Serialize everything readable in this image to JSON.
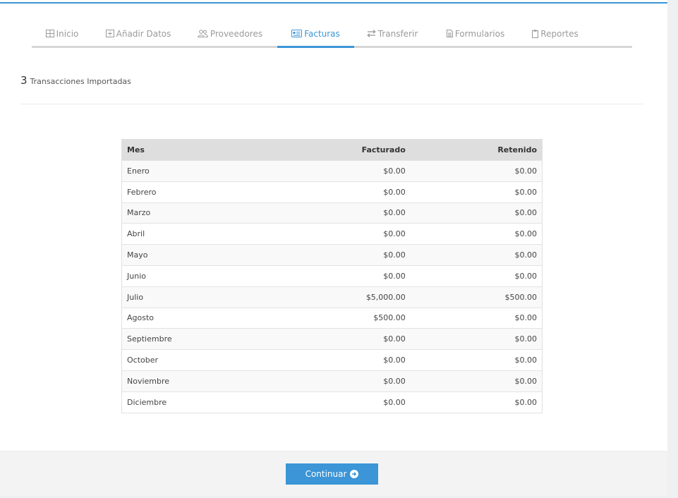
{
  "tabs": [
    {
      "label": "Inicio",
      "icon": "table-icon",
      "active": false
    },
    {
      "label": "Añadir Datos",
      "icon": "plus-square-icon",
      "active": false
    },
    {
      "label": "Proveedores",
      "icon": "users-icon",
      "active": false
    },
    {
      "label": "Facturas",
      "icon": "id-card-icon",
      "active": true
    },
    {
      "label": "Transferir",
      "icon": "exchange-icon",
      "active": false
    },
    {
      "label": "Formularios",
      "icon": "file-icon",
      "active": false
    },
    {
      "label": "Reportes",
      "icon": "clipboard-icon",
      "active": false
    }
  ],
  "summary": {
    "count": "3",
    "label": "Transacciones Importadas"
  },
  "table": {
    "headers": {
      "month": "Mes",
      "billed": "Facturado",
      "withheld": "Retenido"
    },
    "rows": [
      {
        "month": "Enero",
        "billed": "$0.00",
        "withheld": "$0.00"
      },
      {
        "month": "Febrero",
        "billed": "$0.00",
        "withheld": "$0.00"
      },
      {
        "month": "Marzo",
        "billed": "$0.00",
        "withheld": "$0.00"
      },
      {
        "month": "Abril",
        "billed": "$0.00",
        "withheld": "$0.00"
      },
      {
        "month": "Mayo",
        "billed": "$0.00",
        "withheld": "$0.00"
      },
      {
        "month": "Junio",
        "billed": "$0.00",
        "withheld": "$0.00"
      },
      {
        "month": "Julio",
        "billed": "$5,000.00",
        "withheld": "$500.00"
      },
      {
        "month": "Agosto",
        "billed": "$500.00",
        "withheld": "$0.00"
      },
      {
        "month": "Septiembre",
        "billed": "$0.00",
        "withheld": "$0.00"
      },
      {
        "month": "October",
        "billed": "$0.00",
        "withheld": "$0.00"
      },
      {
        "month": "Noviembre",
        "billed": "$0.00",
        "withheld": "$0.00"
      },
      {
        "month": "Diciembre",
        "billed": "$0.00",
        "withheld": "$0.00"
      }
    ]
  },
  "footer": {
    "continue_label": "Continuar",
    "continue_icon": "arrow-circle-right-icon"
  },
  "colors": {
    "accent": "#3b95d6",
    "tab_inactive": "#9a9a9a",
    "header_bg": "#dedede"
  }
}
